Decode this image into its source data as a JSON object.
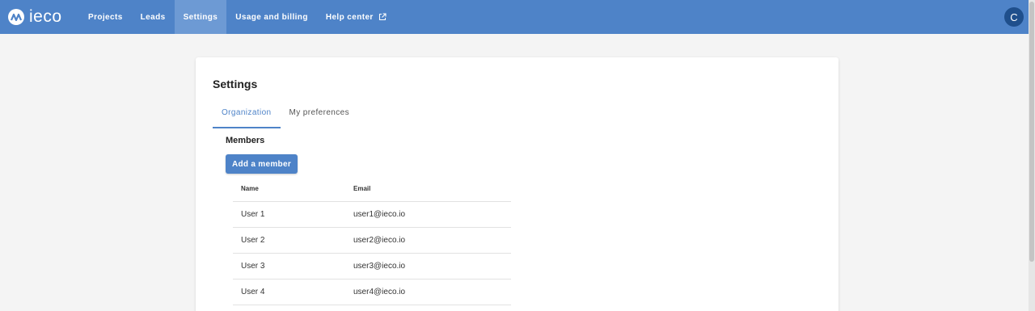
{
  "brand": {
    "name": "ieco"
  },
  "nav": {
    "items": [
      {
        "label": "Projects"
      },
      {
        "label": "Leads"
      },
      {
        "label": "Settings",
        "active": true
      },
      {
        "label": "Usage and billing"
      },
      {
        "label": "Help center",
        "icon": "external-link-icon"
      }
    ]
  },
  "user": {
    "avatar_initial": "C"
  },
  "settings": {
    "title": "Settings",
    "tabs": [
      {
        "label": "Organization",
        "active": true
      },
      {
        "label": "My preferences"
      }
    ],
    "members": {
      "section_title": "Members",
      "add_button_label": "Add a member",
      "columns": [
        "Name",
        "Email"
      ],
      "rows": [
        {
          "name": "User 1",
          "email": "user1@ieco.io"
        },
        {
          "name": "User 2",
          "email": "user2@ieco.io"
        },
        {
          "name": "User 3",
          "email": "user3@ieco.io"
        },
        {
          "name": "User 4",
          "email": "user4@ieco.io"
        }
      ]
    }
  },
  "colors": {
    "header": "#4e83c8",
    "active_nav": "#6d9ad4",
    "avatar": "#1f4f8c",
    "background": "#f4f4f4"
  }
}
